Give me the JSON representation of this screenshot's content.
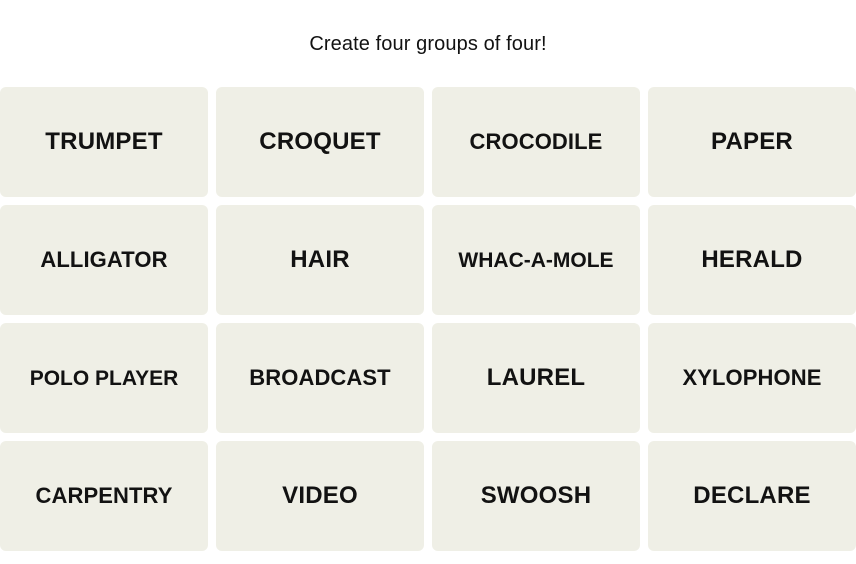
{
  "page": {
    "background_color": "#ffffff",
    "text_color": "#121212"
  },
  "header": {
    "instruction": "Create four groups of four!"
  },
  "board": {
    "tile_color": "#EFEFE6",
    "tile_text_color": "#121212",
    "rows": 4,
    "columns": 4,
    "tiles": [
      {
        "label": "TRUMPET"
      },
      {
        "label": "CROQUET"
      },
      {
        "label": "CROCODILE"
      },
      {
        "label": "PAPER"
      },
      {
        "label": "ALLIGATOR"
      },
      {
        "label": "HAIR"
      },
      {
        "label": "WHAC-A-MOLE"
      },
      {
        "label": "HERALD"
      },
      {
        "label": "POLO PLAYER"
      },
      {
        "label": "BROADCAST"
      },
      {
        "label": "LAUREL"
      },
      {
        "label": "XYLOPHONE"
      },
      {
        "label": "CARPENTRY"
      },
      {
        "label": "VIDEO"
      },
      {
        "label": "SWOOSH"
      },
      {
        "label": "DECLARE"
      }
    ]
  }
}
